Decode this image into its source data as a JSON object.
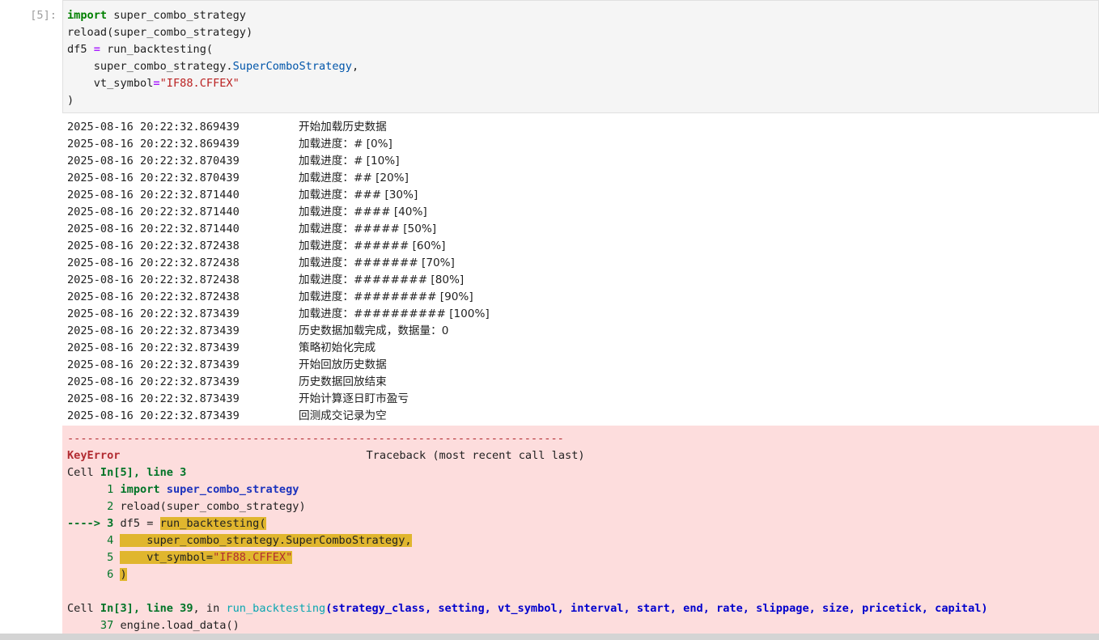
{
  "cell": {
    "prompt": "[5]:",
    "code": {
      "l1_kw": "import",
      "l1_rest": " super_combo_strategy",
      "l2": "reload(super_combo_strategy)",
      "l3_a": "df5 ",
      "l3_op": "=",
      "l3_b": " run_backtesting(",
      "l4_a": "    super_combo_strategy.",
      "l4_attr": "SuperComboStrategy",
      "l4_b": ",",
      "l5_a": "    vt_symbol",
      "l5_op": "=",
      "l5_str": "\"IF88.CFFEX\"",
      "l6": ")"
    }
  },
  "log": [
    {
      "ts": "2025-08-16 20:22:32.869439",
      "msg": "开始加载历史数据"
    },
    {
      "ts": "2025-08-16 20:22:32.869439",
      "msg": "加载进度：# [0%]"
    },
    {
      "ts": "2025-08-16 20:22:32.870439",
      "msg": "加载进度：# [10%]"
    },
    {
      "ts": "2025-08-16 20:22:32.870439",
      "msg": "加载进度：## [20%]"
    },
    {
      "ts": "2025-08-16 20:22:32.871440",
      "msg": "加载进度：### [30%]"
    },
    {
      "ts": "2025-08-16 20:22:32.871440",
      "msg": "加载进度：#### [40%]"
    },
    {
      "ts": "2025-08-16 20:22:32.871440",
      "msg": "加载进度：##### [50%]"
    },
    {
      "ts": "2025-08-16 20:22:32.872438",
      "msg": "加载进度：###### [60%]"
    },
    {
      "ts": "2025-08-16 20:22:32.872438",
      "msg": "加载进度：####### [70%]"
    },
    {
      "ts": "2025-08-16 20:22:32.872438",
      "msg": "加载进度：######## [80%]"
    },
    {
      "ts": "2025-08-16 20:22:32.872438",
      "msg": "加载进度：######### [90%]"
    },
    {
      "ts": "2025-08-16 20:22:32.873439",
      "msg": "加载进度：########## [100%]"
    },
    {
      "ts": "2025-08-16 20:22:32.873439",
      "msg": "历史数据加载完成，数据量：0"
    },
    {
      "ts": "2025-08-16 20:22:32.873439",
      "msg": "策略初始化完成"
    },
    {
      "ts": "2025-08-16 20:22:32.873439",
      "msg": "开始回放历史数据"
    },
    {
      "ts": "2025-08-16 20:22:32.873439",
      "msg": "历史数据回放结束"
    },
    {
      "ts": "2025-08-16 20:22:32.873439",
      "msg": "开始计算逐日盯市盈亏"
    },
    {
      "ts": "2025-08-16 20:22:32.873439",
      "msg": "回测成交记录为空"
    }
  ],
  "error": {
    "dashes": "---------------------------------------------------------------------------",
    "type": "KeyError",
    "traceback_label": "Traceback (most recent call last)",
    "cell1": {
      "cell": "Cell ",
      "in": "In[5]",
      "sep": ", ",
      "line": "line 3"
    },
    "tb1": [
      {
        "num": "      1 ",
        "kw": "import",
        "mod": " super_combo_strategy"
      },
      {
        "num": "      2 ",
        "text": "reload(super_combo_strategy)"
      },
      {
        "arrow": "----> 3 ",
        "pre": "df5 = ",
        "hl": "run_backtesting("
      },
      {
        "num": "      4 ",
        "hl": "    super_combo_strategy.SuperComboStrategy,"
      },
      {
        "num": "      5 ",
        "hl_a": "    vt_symbol=",
        "hl_str": "\"IF88.CFFEX\""
      },
      {
        "num": "      6 ",
        "hl": ")"
      }
    ],
    "cell2": {
      "cell": "Cell ",
      "in": "In[3]",
      "sep": ", ",
      "line": "line 39",
      "in_word": ", in ",
      "func": "run_backtesting",
      "args": "(strategy_class, setting, vt_symbol, interval, start, end, rate, slippage, size, pricetick, capital)"
    },
    "tb2_line": {
      "num": "     37 ",
      "text": "engine.load_data()"
    }
  },
  "colors": {
    "code_bg": "#f5f5f5",
    "error_bg": "#fddddd",
    "highlight": "#e0b62e",
    "keyword_green": "#008000",
    "error_red": "#b22b31"
  }
}
